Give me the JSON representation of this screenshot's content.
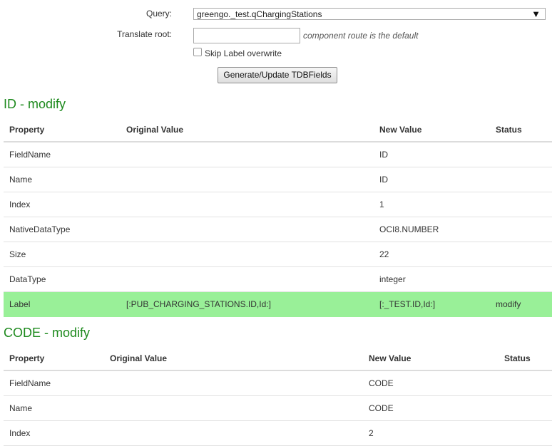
{
  "form": {
    "query_label": "Query:",
    "query_value": "greengo._test.qChargingStations",
    "translate_label": "Translate root:",
    "translate_value": "",
    "translate_hint": "component route is the default",
    "skip_label": "Skip Label overwrite",
    "generate_button": "Generate/Update TDBFields"
  },
  "sections": [
    {
      "title": "ID - modify",
      "headers": [
        "Property",
        "Original Value",
        "New Value",
        "Status"
      ],
      "rows": [
        {
          "property": "FieldName",
          "original": "",
          "new": "ID",
          "status": ""
        },
        {
          "property": "Name",
          "original": "",
          "new": "ID",
          "status": ""
        },
        {
          "property": "Index",
          "original": "",
          "new": "1",
          "status": ""
        },
        {
          "property": "NativeDataType",
          "original": "",
          "new": "OCI8.NUMBER",
          "status": ""
        },
        {
          "property": "Size",
          "original": "",
          "new": "22",
          "status": ""
        },
        {
          "property": "DataType",
          "original": "",
          "new": "integer",
          "status": ""
        },
        {
          "property": "Label",
          "original": "[:PUB_CHARGING_STATIONS.ID,Id:]",
          "new": "[:_TEST.ID,Id:]",
          "status": "modify"
        }
      ]
    },
    {
      "title": "CODE - modify",
      "headers": [
        "Property",
        "Original Value",
        "New Value",
        "Status"
      ],
      "rows": [
        {
          "property": "FieldName",
          "original": "",
          "new": "CODE",
          "status": ""
        },
        {
          "property": "Name",
          "original": "",
          "new": "CODE",
          "status": ""
        },
        {
          "property": "Index",
          "original": "",
          "new": "2",
          "status": ""
        }
      ]
    }
  ],
  "colors": {
    "title_green": "#1e8a1e",
    "highlight_green": "#99f098"
  }
}
